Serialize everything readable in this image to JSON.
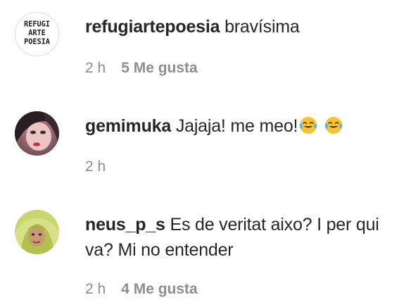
{
  "comments": [
    {
      "username": "refugiartepoesia",
      "text": "bravísima",
      "time": "2 h",
      "likes": "5 Me gusta",
      "avatar_logo_lines": [
        "REFUGI",
        "ARTE",
        "POESIA"
      ]
    },
    {
      "username": "gemimuka",
      "text": "Jajaja! me meo!",
      "emojis": [
        "tears-of-joy-emoji",
        "tears-of-joy-emoji"
      ],
      "time": "2 h",
      "likes": ""
    },
    {
      "username": "neus_p_s",
      "text": "Es de veritat aixo? I per qui va? Mi no entender",
      "time": "2 h",
      "likes": "4 Me gusta"
    }
  ],
  "colors": {
    "text": "#262626",
    "secondary": "#8e8e8e",
    "emoji_face": "#f7c42b"
  }
}
